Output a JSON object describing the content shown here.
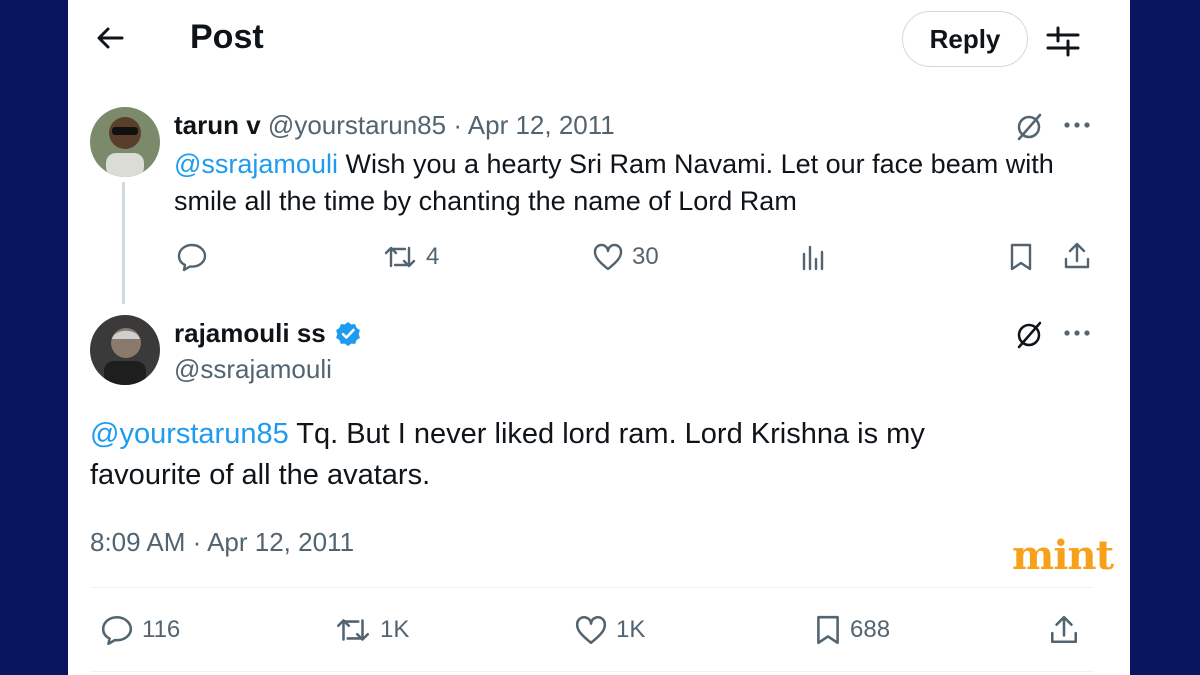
{
  "header": {
    "title": "Post",
    "reply_label": "Reply"
  },
  "parent_tweet": {
    "name": "tarun v",
    "handle": "@yourstarun85",
    "separator": "·",
    "date": "Apr 12, 2011",
    "mention": "@ssrajamouli",
    "text_line1": " Wish you a hearty Sri Ram Navami. Let our face beam with",
    "text_line2": "smile all the time by chanting the name of Lord Ram",
    "stats": {
      "replies": "",
      "reposts": "4",
      "likes": "30"
    }
  },
  "main_tweet": {
    "name": "rajamouli ss",
    "handle": "@ssrajamouli",
    "mention": "@yourstarun85",
    "text_line1": " Tq. But I never liked lord ram. Lord Krishna is my",
    "text_line2": "favourite of all the avatars.",
    "timestamp": "8:09 AM · Apr 12, 2011",
    "stats": {
      "replies": "116",
      "reposts": "1K",
      "likes": "1K",
      "bookmarks": "688"
    }
  },
  "watermark": "mint",
  "colors": {
    "accent": "#1d9bf0",
    "muted": "#536471",
    "background": "#0a1560",
    "watermark": "#f7a11a"
  },
  "icons": [
    "back-arrow-icon",
    "filter-icon",
    "grok-icon",
    "more-icon",
    "reply-icon",
    "repost-icon",
    "like-icon",
    "views-icon",
    "bookmark-icon",
    "share-icon",
    "verified-badge-icon"
  ]
}
